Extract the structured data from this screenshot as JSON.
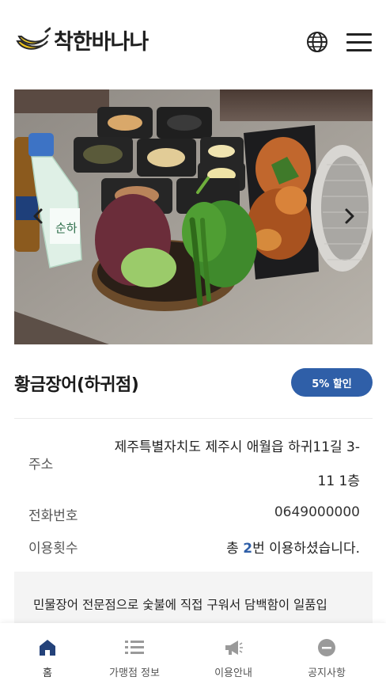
{
  "header": {
    "logo_text": "착한바나나",
    "logo_icon": "banana-logo-icon",
    "globe_icon": "globe-icon",
    "menu_icon": "hamburger-menu-icon"
  },
  "hero": {
    "prev_icon": "chevron-left-icon",
    "next_icon": "chevron-right-icon",
    "bottle_label": "순하"
  },
  "store": {
    "name": "황금장어(하귀점)",
    "discount_label": "5% 할인"
  },
  "info": {
    "address_label": "주소",
    "address_line1": "제주특별자치도 제주시 애월읍 하귀11길 3-",
    "address_line2": "11 1층",
    "phone_label": "전화번호",
    "phone_value": "0649000000",
    "visits_label": "이용횟수",
    "visits_prefix": "총 ",
    "visits_count": "2",
    "visits_suffix": "번 이용하셨습니다."
  },
  "description": "민물장어 전문점으로 숯불에 직접 구워서 담백함이 일품입",
  "nav": {
    "items": [
      {
        "label": "홈",
        "icon": "home-icon"
      },
      {
        "label": "가맹점 정보",
        "icon": "list-icon"
      },
      {
        "label": "이용안내",
        "icon": "megaphone-icon"
      },
      {
        "label": "공지사항",
        "icon": "notice-icon"
      }
    ]
  },
  "colors": {
    "accent": "#2f5fa8",
    "logo_yellow": "#f2c511",
    "nav_active": "#24427a",
    "nav_inactive": "#9a9a9a"
  }
}
